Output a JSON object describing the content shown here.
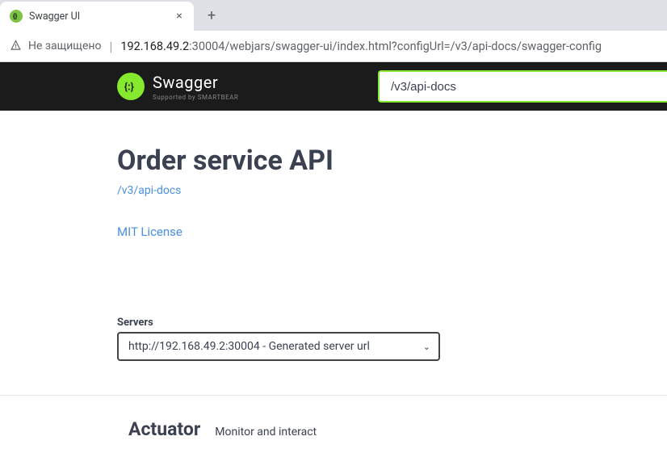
{
  "browser": {
    "tab_title": "Swagger UI",
    "security_label": "Не защищено",
    "url_host": "192.168.49.2",
    "url_path": ":30004/webjars/swagger-ui/index.html?configUrl=/v3/api-docs/swagger-config"
  },
  "header": {
    "brand": "Swagger",
    "supported_by": "Supported by SMARTBEAR",
    "spec_value": "/v3/api-docs"
  },
  "api": {
    "title": "Order service API",
    "spec_link": "/v3/api-docs",
    "license": "MIT License"
  },
  "servers": {
    "label": "Servers",
    "selected": "http://192.168.49.2:30004 - Generated server url"
  },
  "tag": {
    "name": "Actuator",
    "description": "Monitor and interact"
  }
}
